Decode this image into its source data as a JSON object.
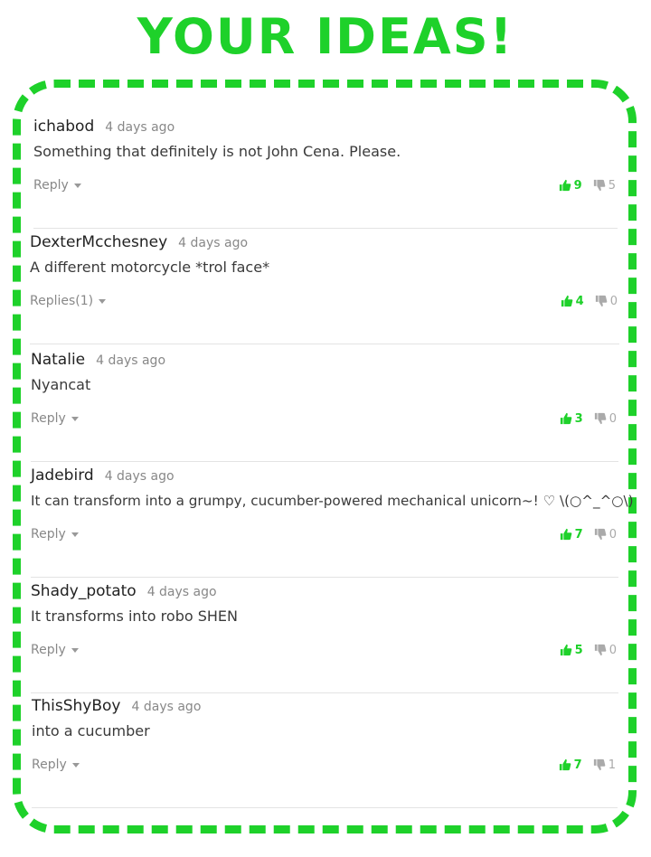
{
  "header": {
    "title": "YOUR IDEAS!"
  },
  "colors": {
    "accent": "#1ed12a",
    "muted": "#aaaaaa",
    "divider": "#e3e3e3"
  },
  "icons": {
    "upvote": "thumbs-up-icon",
    "downvote": "thumbs-down-icon",
    "reply_menu": "caret-down-icon"
  },
  "comments": [
    {
      "author": "ichabod",
      "time": "4 days ago",
      "text": "Something that definitely is not John Cena. Please.",
      "reply_label": "Reply",
      "upvotes": "9",
      "downvotes": "5"
    },
    {
      "author": "DexterMcchesney",
      "time": "4 days ago",
      "text": "A different motorcycle *trol face*",
      "reply_label": "Replies(1)",
      "upvotes": "4",
      "downvotes": "0"
    },
    {
      "author": "Natalie",
      "time": "4 days ago",
      "text": "Nyancat",
      "reply_label": "Reply",
      "upvotes": "3",
      "downvotes": "0"
    },
    {
      "author": "Jadebird",
      "time": "4 days ago",
      "text": "It can transform into a grumpy, cucumber-powered mechanical unicorn~! ♡ \\(○^_^○\\)",
      "reply_label": "Reply",
      "upvotes": "7",
      "downvotes": "0"
    },
    {
      "author": "Shady_potato",
      "time": "4 days ago",
      "text": "It transforms into robo SHEN",
      "reply_label": "Reply",
      "upvotes": "5",
      "downvotes": "0"
    },
    {
      "author": "ThisShyBoy",
      "time": "4 days ago",
      "text": "into a cucumber",
      "reply_label": "Reply",
      "upvotes": "7",
      "downvotes": "1"
    }
  ]
}
